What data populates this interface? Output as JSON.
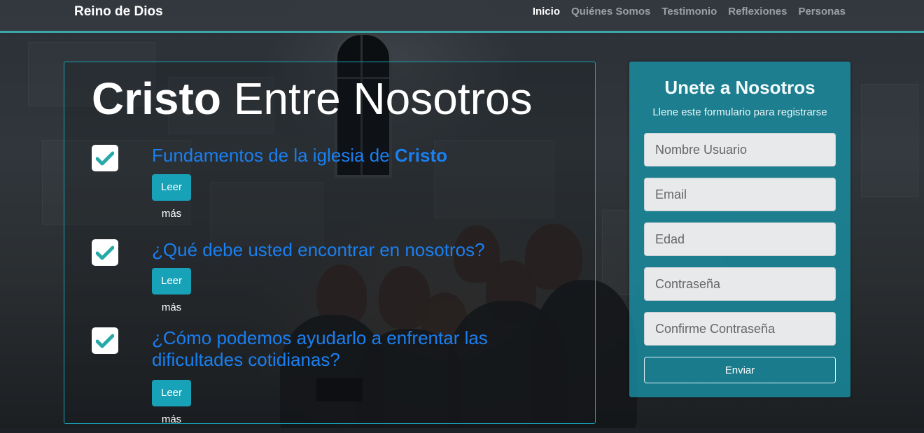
{
  "navbar": {
    "brand": "Reino de Dios",
    "links": [
      "Inicio",
      "Quiénes Somos",
      "Testimonio",
      "Reflexiones",
      "Personas"
    ]
  },
  "hero": {
    "title_bold": "Cristo",
    "title_rest": " Entre Nosotros"
  },
  "features": [
    {
      "text": "Fundamentos de la iglesia de ",
      "bold": "Cristo",
      "button": "Leer más"
    },
    {
      "text": "¿Qué debe usted encontrar en nosotros?",
      "bold": "",
      "button": "Leer más"
    },
    {
      "text": "¿Cómo podemos ayudarlo a enfrentar las dificultades cotidianas?",
      "bold": "",
      "button": "Leer más"
    }
  ],
  "form": {
    "title": "Unete a Nosotros",
    "subtitle": "Llene este formulario para registrarse",
    "fields": [
      {
        "placeholder": "Nombre Usuario"
      },
      {
        "placeholder": "Email"
      },
      {
        "placeholder": "Edad"
      },
      {
        "placeholder": "Contraseña"
      },
      {
        "placeholder": "Confirme Contraseña"
      }
    ],
    "submit": "Enviar"
  },
  "colors": {
    "accent": "#17a2b8",
    "link_blue": "#1a7ff0",
    "check": "#28a9a9",
    "navbar_border": "#3aa6a6"
  },
  "icons": {
    "check": "check-icon"
  }
}
